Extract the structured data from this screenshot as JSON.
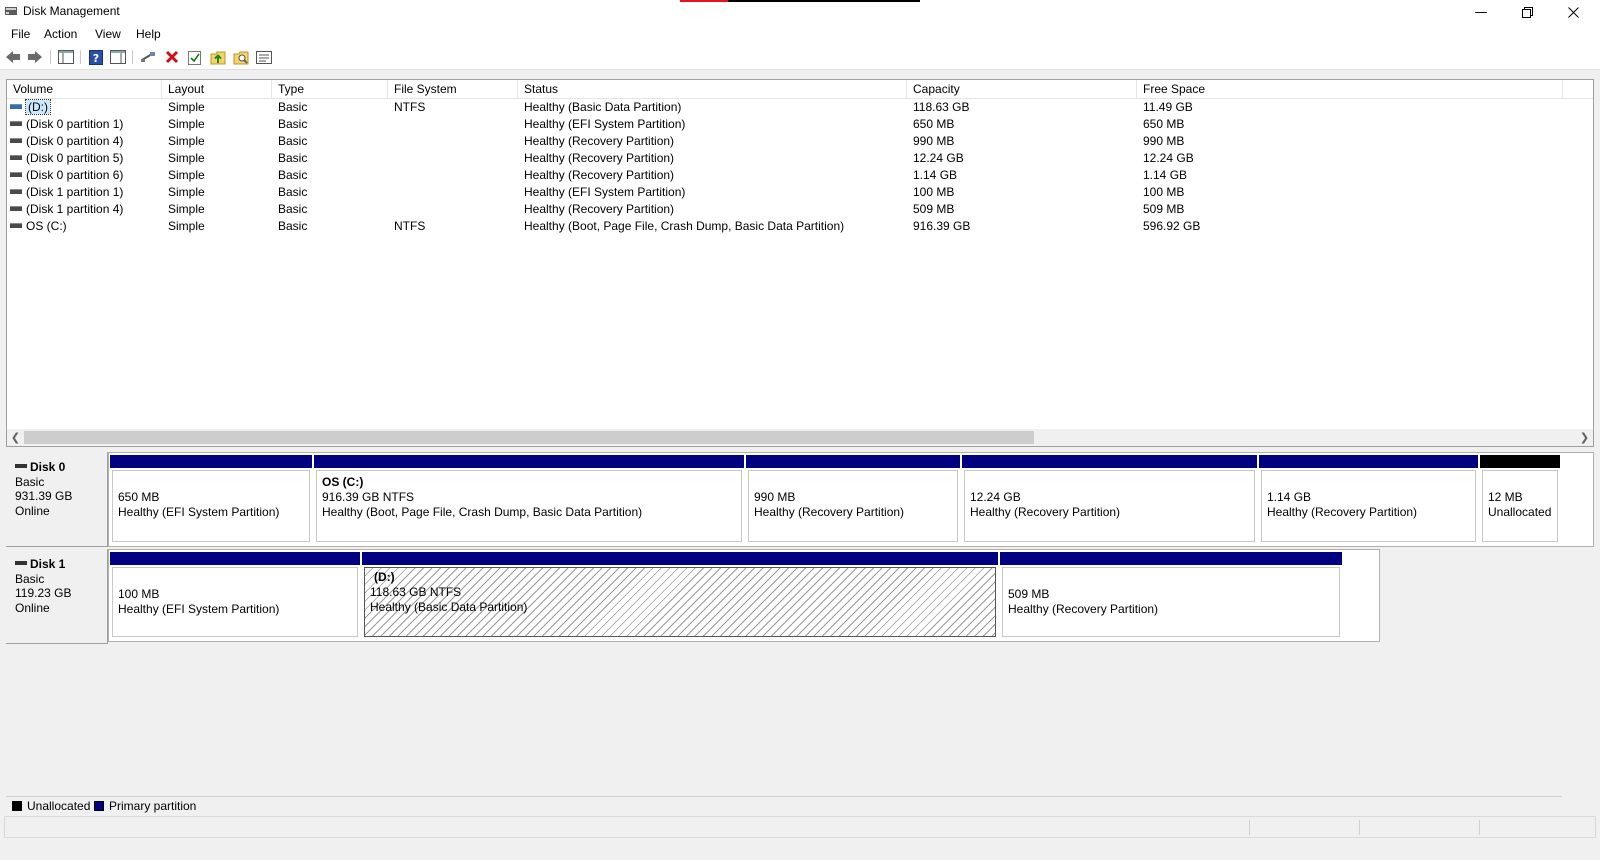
{
  "window": {
    "title": "Disk Management",
    "controls": [
      "minimize",
      "restore",
      "close"
    ]
  },
  "menu": [
    "File",
    "Action",
    "View",
    "Help"
  ],
  "toolbar": [
    "back-icon",
    "forward-icon",
    "console-tree-icon",
    "help-icon",
    "properties-view-icon",
    "connect-icon",
    "delete-icon",
    "check-icon",
    "folder-up-icon",
    "folder-search-icon",
    "list-icon"
  ],
  "list": {
    "columns": [
      "Volume",
      "Layout",
      "Type",
      "File System",
      "Status",
      "Capacity",
      "Free Space"
    ],
    "rows": [
      {
        "volume": "(D:)",
        "layout": "Simple",
        "type": "Basic",
        "fs": "NTFS",
        "status": "Healthy (Basic Data Partition)",
        "capacity": "118.63 GB",
        "free": "11.49 GB",
        "selected": true
      },
      {
        "volume": "(Disk 0 partition 1)",
        "layout": "Simple",
        "type": "Basic",
        "fs": "",
        "status": "Healthy (EFI System Partition)",
        "capacity": "650 MB",
        "free": "650 MB"
      },
      {
        "volume": "(Disk 0 partition 4)",
        "layout": "Simple",
        "type": "Basic",
        "fs": "",
        "status": "Healthy (Recovery Partition)",
        "capacity": "990 MB",
        "free": "990 MB"
      },
      {
        "volume": "(Disk 0 partition 5)",
        "layout": "Simple",
        "type": "Basic",
        "fs": "",
        "status": "Healthy (Recovery Partition)",
        "capacity": "12.24 GB",
        "free": "12.24 GB"
      },
      {
        "volume": "(Disk 0 partition 6)",
        "layout": "Simple",
        "type": "Basic",
        "fs": "",
        "status": "Healthy (Recovery Partition)",
        "capacity": "1.14 GB",
        "free": "1.14 GB"
      },
      {
        "volume": "(Disk 1 partition 1)",
        "layout": "Simple",
        "type": "Basic",
        "fs": "",
        "status": "Healthy (EFI System Partition)",
        "capacity": "100 MB",
        "free": "100 MB"
      },
      {
        "volume": "(Disk 1 partition 4)",
        "layout": "Simple",
        "type": "Basic",
        "fs": "",
        "status": "Healthy (Recovery Partition)",
        "capacity": "509 MB",
        "free": "509 MB"
      },
      {
        "volume": "OS (C:)",
        "layout": "Simple",
        "type": "Basic",
        "fs": "NTFS",
        "status": "Healthy (Boot, Page File, Crash Dump, Basic Data Partition)",
        "capacity": "916.39 GB",
        "free": "596.92 GB"
      }
    ]
  },
  "disks": [
    {
      "name": "Disk 0",
      "type": "Basic",
      "size": "931.39 GB",
      "state": "Online",
      "partitions": [
        {
          "name": "",
          "size": "650 MB",
          "status": "Healthy (EFI System Partition)",
          "kind": "primary"
        },
        {
          "name": "OS  (C:)",
          "size": "916.39 GB NTFS",
          "status": "Healthy (Boot, Page File, Crash Dump, Basic Data Partition)",
          "kind": "primary"
        },
        {
          "name": "",
          "size": "990 MB",
          "status": "Healthy (Recovery Partition)",
          "kind": "primary"
        },
        {
          "name": "",
          "size": "12.24 GB",
          "status": "Healthy (Recovery Partition)",
          "kind": "primary"
        },
        {
          "name": "",
          "size": "1.14 GB",
          "status": "Healthy (Recovery Partition)",
          "kind": "primary"
        },
        {
          "name": "",
          "size": "12 MB",
          "status": "Unallocated",
          "kind": "unallocated"
        }
      ]
    },
    {
      "name": "Disk 1",
      "type": "Basic",
      "size": "119.23 GB",
      "state": "Online",
      "partitions": [
        {
          "name": "",
          "size": "100 MB",
          "status": "Healthy (EFI System Partition)",
          "kind": "primary"
        },
        {
          "name": "(D:)",
          "size": "118.63 GB NTFS",
          "status": "Healthy (Basic Data Partition)",
          "kind": "primary",
          "selected": true
        },
        {
          "name": "",
          "size": "509 MB",
          "status": "Healthy (Recovery Partition)",
          "kind": "primary"
        }
      ]
    }
  ],
  "legend": [
    {
      "label": "Unallocated",
      "color": "#000000"
    },
    {
      "label": "Primary partition",
      "color": "#000080"
    }
  ],
  "colors": {
    "primary": "#000080",
    "unallocated": "#000000",
    "selection": "#cce8ff"
  }
}
